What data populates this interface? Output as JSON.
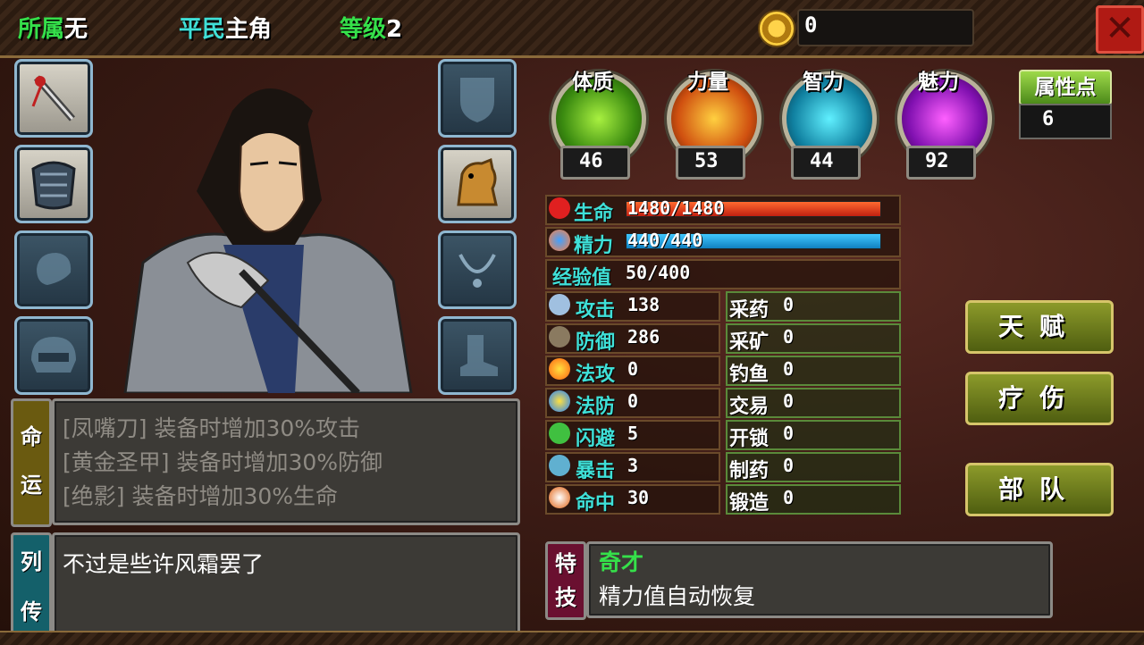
{
  "top": {
    "faction_label": "所属",
    "faction_value": "无",
    "identity_label": "平民",
    "identity_value": "主角",
    "level_label": "等级",
    "level_value": "2",
    "coins": "0",
    "close_icon": "close-x-icon"
  },
  "equipment": {
    "left": [
      "sword-icon",
      "armor-icon",
      "cloak-icon",
      "helmet-icon"
    ],
    "right": [
      "shield-icon",
      "horse-icon",
      "necklace-icon",
      "boot-icon"
    ]
  },
  "attributes": [
    {
      "label": "体质",
      "value": "46",
      "color": "#6fd02a"
    },
    {
      "label": "力量",
      "value": "53",
      "color": "#e07a10"
    },
    {
      "label": "智力",
      "value": "44",
      "color": "#20b8d8"
    },
    {
      "label": "魅力",
      "value": "92",
      "color": "#b020d0"
    }
  ],
  "attr_points": {
    "label": "属性点",
    "value": "6"
  },
  "hp": {
    "label": "生命",
    "value": "1480/1480",
    "ratio": 1.0
  },
  "mp": {
    "label": "精力",
    "value": "440/440",
    "ratio": 1.0
  },
  "exp": {
    "label": "经验值",
    "value": "50/400"
  },
  "combat_stats": [
    {
      "label": "攻击",
      "value": "138"
    },
    {
      "label": "防御",
      "value": "286"
    },
    {
      "label": "法攻",
      "value": "0"
    },
    {
      "label": "法防",
      "value": "0"
    },
    {
      "label": "闪避",
      "value": "5"
    },
    {
      "label": "暴击",
      "value": "3"
    },
    {
      "label": "命中",
      "value": "30"
    }
  ],
  "life_skills": [
    {
      "label": "采药",
      "value": "0"
    },
    {
      "label": "采矿",
      "value": "0"
    },
    {
      "label": "钓鱼",
      "value": "0"
    },
    {
      "label": "交易",
      "value": "0"
    },
    {
      "label": "开锁",
      "value": "0"
    },
    {
      "label": "制药",
      "value": "0"
    },
    {
      "label": "锻造",
      "value": "0"
    }
  ],
  "buttons": {
    "talent": "天赋",
    "heal": "疗伤",
    "troops": "部队"
  },
  "fate": {
    "tag_1": "命",
    "tag_2": "运",
    "lines": [
      "[凤嘴刀] 装备时增加30%攻击",
      "[黄金圣甲] 装备时增加30%防御",
      "[绝影] 装备时增加30%生命"
    ]
  },
  "biography": {
    "tag_1": "列",
    "tag_2": "传",
    "text": "不过是些许风霜罢了"
  },
  "specialty": {
    "tag_1": "特",
    "tag_2": "技",
    "title": "奇才",
    "desc": "精力值自动恢复"
  }
}
